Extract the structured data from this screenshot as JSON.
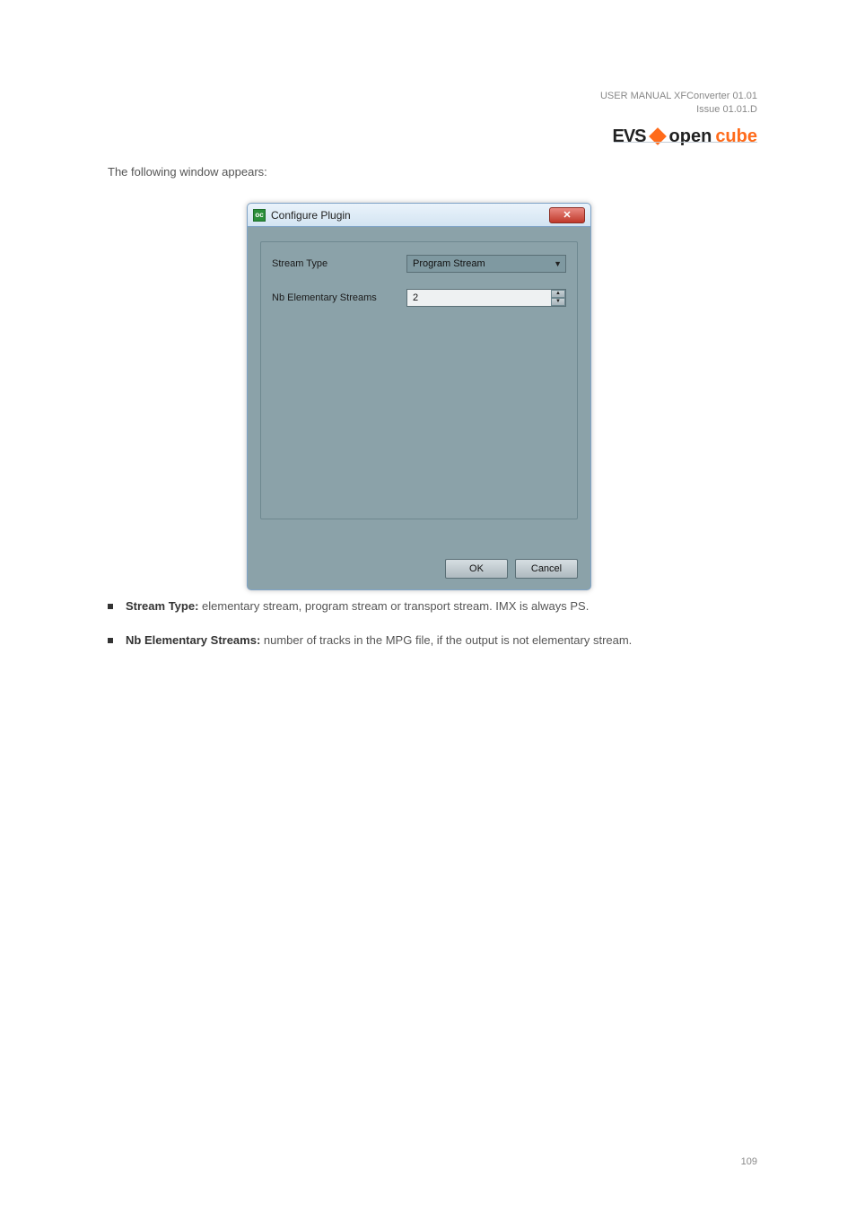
{
  "header": {
    "meta": "USER MANUAL XFConverter 01.01\nIssue 01.01.D",
    "logo_evs": "EVS",
    "logo_open": "open",
    "logo_cube": "cube"
  },
  "intro": "The following window appears:",
  "dialog": {
    "title": "Configure Plugin",
    "close_glyph": "✕",
    "stream_type_label": "Stream Type",
    "stream_type_value": "Program Stream",
    "nb_streams_label": "Nb Elementary Streams",
    "nb_streams_value": "2",
    "ok": "OK",
    "cancel": "Cancel"
  },
  "notes": [
    {
      "label": "Stream Type:",
      "text": " elementary stream, program stream or transport stream. IMX is always PS."
    },
    {
      "label": "Nb Elementary Streams:",
      "text": " number of tracks in the MPG file, if the output is not elementary stream."
    }
  ],
  "footer": {
    "page": "109"
  }
}
